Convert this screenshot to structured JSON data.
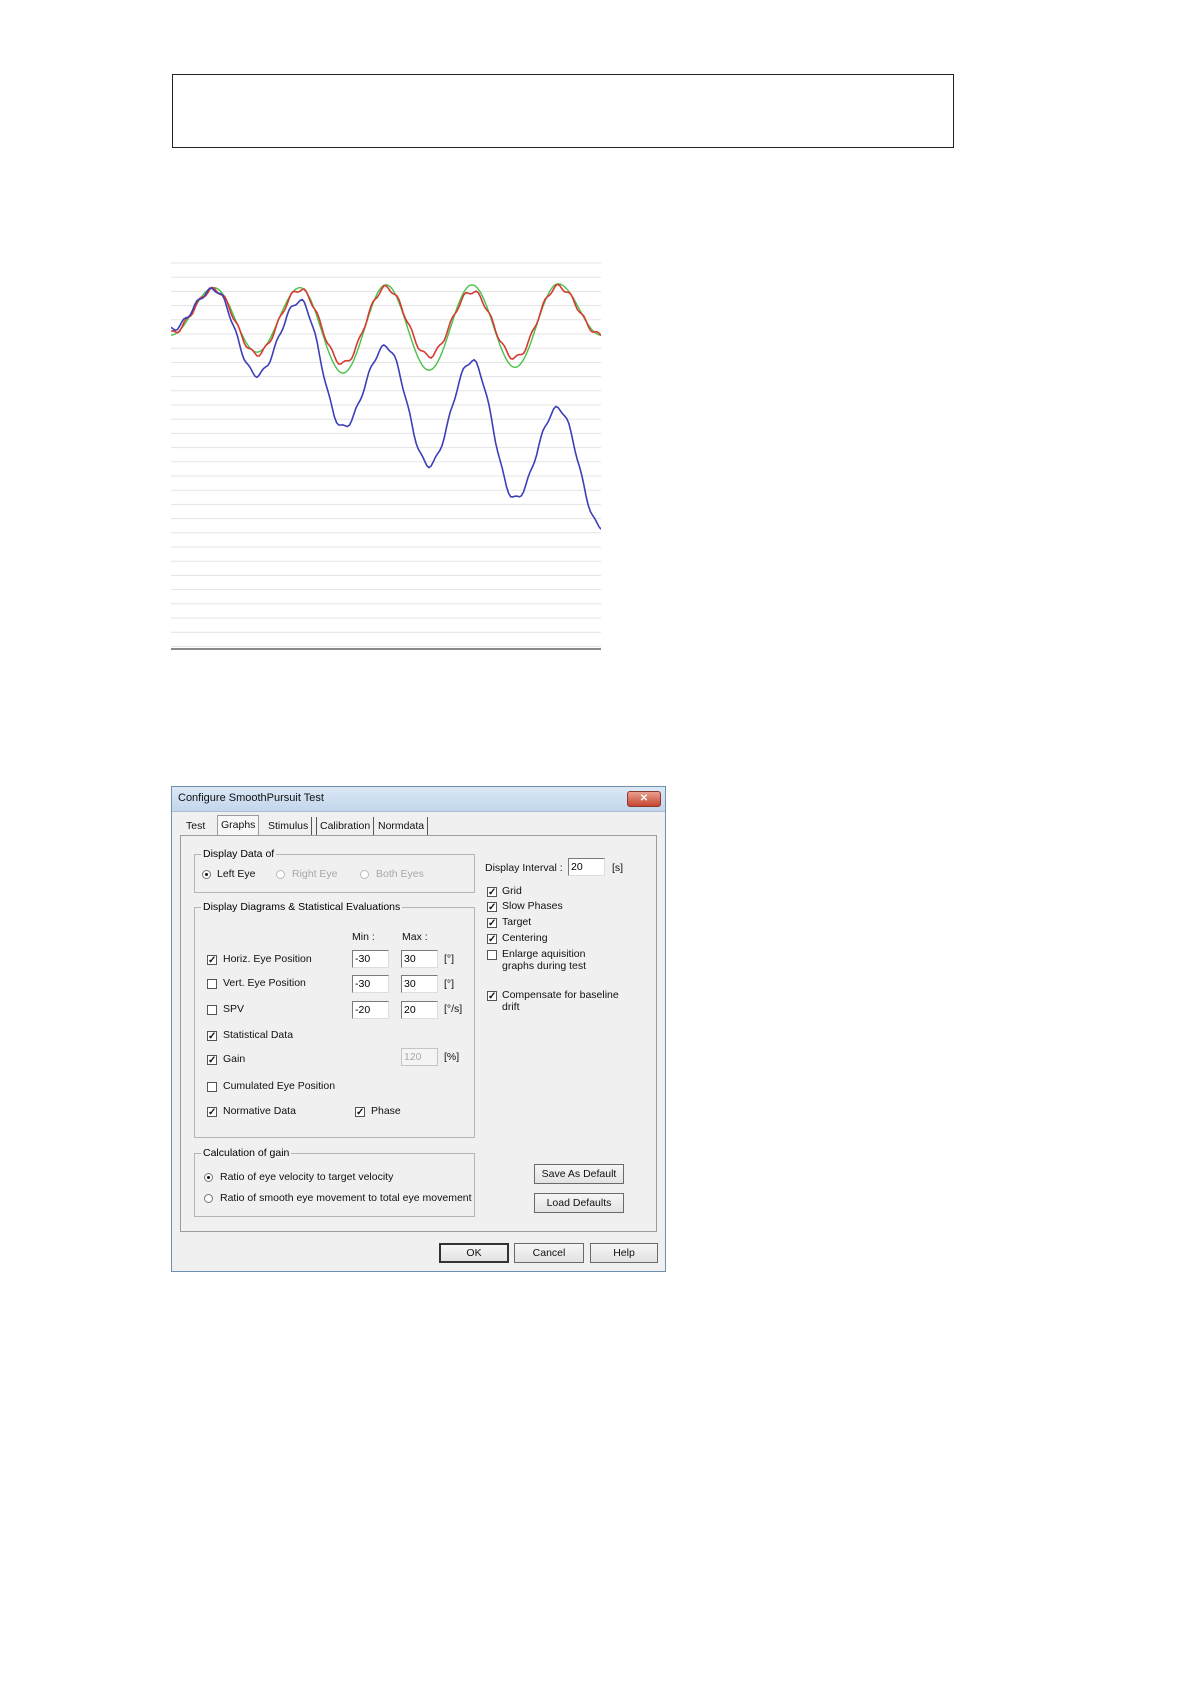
{
  "chart_data": {
    "type": "line",
    "title": "",
    "xlabel": "",
    "ylabel": "",
    "grid": true,
    "series": [
      {
        "color": "#49c24a",
        "values": [
          0.42,
          0.92,
          0.24,
          0.92,
          0.02,
          0.95,
          0.05,
          0.95,
          0.08,
          0.96,
          0.42
        ]
      },
      {
        "color": "#d63a32",
        "values": [
          0.44,
          0.9,
          0.22,
          0.9,
          0.12,
          0.92,
          0.2,
          0.88,
          0.18,
          0.93,
          0.42
        ]
      },
      {
        "color": "#3d3fb8",
        "values": [
          0.48,
          0.9,
          0.0,
          0.78,
          -0.55,
          0.3,
          -0.95,
          0.15,
          -1.3,
          -0.35,
          -1.6
        ]
      }
    ],
    "x": [
      0,
      0.1,
      0.2,
      0.3,
      0.4,
      0.5,
      0.6,
      0.7,
      0.8,
      0.9,
      1.0
    ]
  },
  "dialog": {
    "title": "Configure SmoothPursuit Test",
    "close": "✕",
    "tabs": [
      "Test",
      "Graphs",
      "Stimulus",
      "Calibration",
      "Normdata"
    ],
    "display_data": {
      "legend": "Display Data of",
      "left": "Left Eye",
      "right": "Right Eye",
      "both": "Both Eyes"
    },
    "diagrams": {
      "legend": "Display Diagrams & Statistical Evaluations",
      "min_label": "Min :",
      "max_label": "Max :",
      "horiz": {
        "label": "Horiz. Eye Position",
        "min": "-30",
        "max": "30",
        "unit": "[°]"
      },
      "vert": {
        "label": "Vert. Eye Position",
        "min": "-30",
        "max": "30",
        "unit": "[°]"
      },
      "spv": {
        "label": "SPV",
        "min": "-20",
        "max": "20",
        "unit": "[°/s]"
      },
      "statistical": "Statistical Data",
      "gain": {
        "label": "Gain",
        "max": "120",
        "unit": "[%]"
      },
      "cumulated": "Cumulated Eye Position",
      "normative": "Normative Data",
      "phase": "Phase"
    },
    "calc_gain": {
      "legend": "Calculation of gain",
      "opt1": "Ratio of eye velocity to target velocity",
      "opt2": "Ratio of smooth eye movement to total eye movement"
    },
    "right": {
      "interval_label": "Display Interval :",
      "interval_value": "20",
      "interval_unit": "[s]",
      "grid": "Grid",
      "slow_phases": "Slow Phases",
      "target": "Target",
      "centering": "Centering",
      "enlarge_1": "Enlarge aquisition",
      "enlarge_2": "graphs during test",
      "compensate_1": "Compensate for baseline",
      "compensate_2": "drift",
      "save_default": "Save As Default",
      "load_defaults": "Load Defaults"
    },
    "buttons": {
      "ok": "OK",
      "cancel": "Cancel",
      "help": "Help"
    }
  }
}
